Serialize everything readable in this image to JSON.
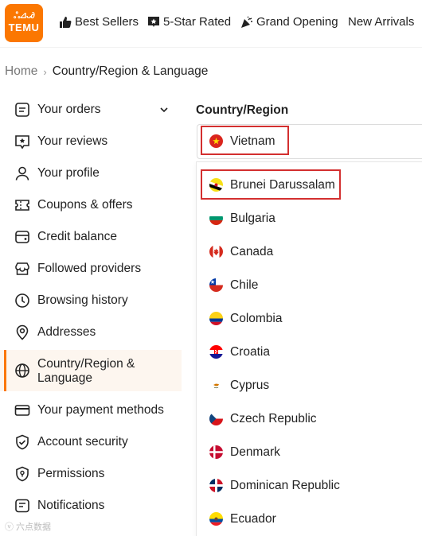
{
  "header": {
    "logo_text": "TEMU",
    "logo_mark": "ஃ⊿ᴗ∂",
    "nav": [
      {
        "label": "Best Sellers",
        "icon": "thumbs-up-icon"
      },
      {
        "label": "5-Star Rated",
        "icon": "star-badge-icon"
      },
      {
        "label": "Grand Opening",
        "icon": "party-popper-icon"
      },
      {
        "label": "New Arrivals",
        "icon": ""
      }
    ]
  },
  "breadcrumb": {
    "home": "Home",
    "separator": "›",
    "current": "Country/Region & Language"
  },
  "sidebar": {
    "items": [
      {
        "label": "Your orders",
        "icon": "order-list-icon"
      },
      {
        "label": "Your reviews",
        "icon": "review-icon"
      },
      {
        "label": "Your profile",
        "icon": "user-icon"
      },
      {
        "label": "Coupons & offers",
        "icon": "coupon-icon"
      },
      {
        "label": "Credit balance",
        "icon": "credit-icon"
      },
      {
        "label": "Followed providers",
        "icon": "store-icon"
      },
      {
        "label": "Browsing history",
        "icon": "clock-icon"
      },
      {
        "label": "Addresses",
        "icon": "location-icon"
      },
      {
        "label": "Country/Region &",
        "label2": "Language",
        "icon": "globe-icon",
        "active": true
      },
      {
        "label": "Your payment methods",
        "icon": "card-icon"
      },
      {
        "label": "Account security",
        "icon": "shield-check-icon"
      },
      {
        "label": "Permissions",
        "icon": "shield-lock-icon"
      },
      {
        "label": "Notifications",
        "icon": "bell-icon"
      }
    ]
  },
  "main": {
    "section_label": "Country/Region",
    "selected_country": "Vietnam",
    "options": [
      "Brunei Darussalam",
      "Bulgaria",
      "Canada",
      "Chile",
      "Colombia",
      "Croatia",
      "Cyprus",
      "Czech Republic",
      "Denmark",
      "Dominican Republic",
      "Ecuador"
    ]
  },
  "colors": {
    "brand": "#fb7701",
    "highlight_box": "#d32f2f"
  },
  "watermark": "ⓥ 六点数据"
}
